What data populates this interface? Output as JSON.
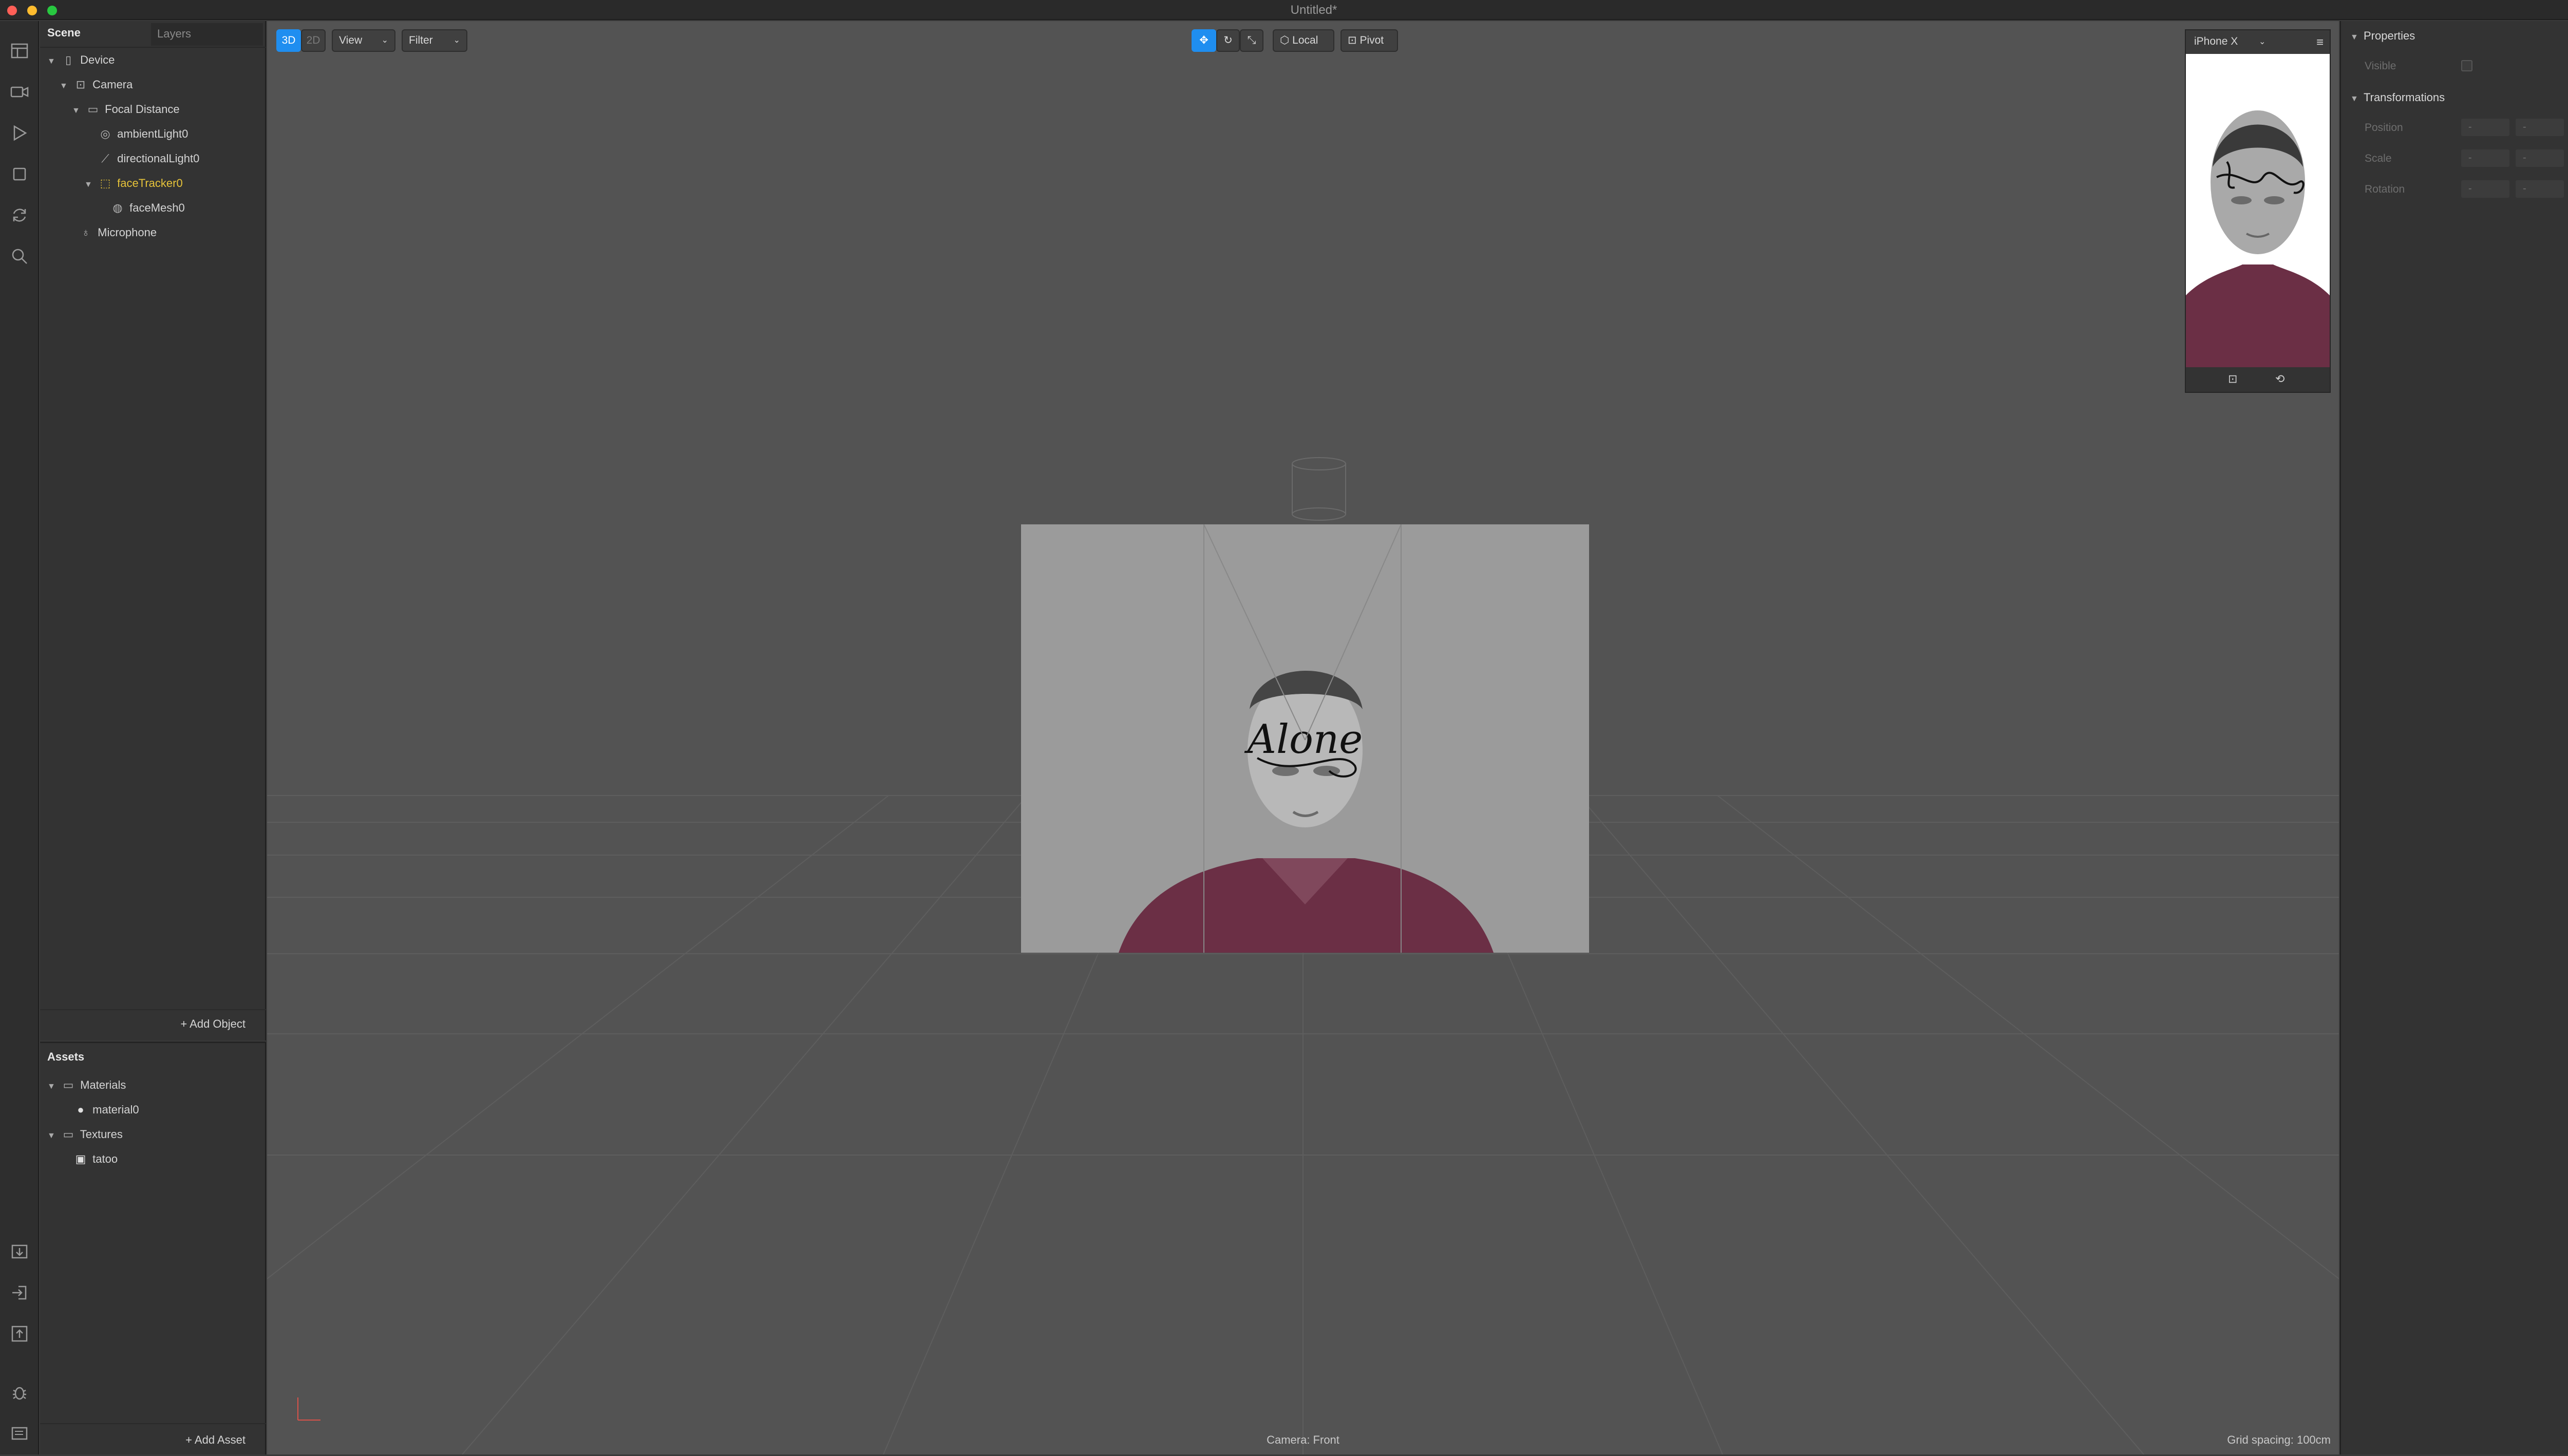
{
  "window": {
    "title": "Untitled*"
  },
  "scene_panel": {
    "tabs": [
      "Scene",
      "Layers"
    ],
    "tree": [
      {
        "label": "Device",
        "icon": "phone-icon",
        "expanded": true
      },
      {
        "label": "Camera",
        "icon": "video-camera-icon",
        "expanded": true
      },
      {
        "label": "Focal Distance",
        "icon": "ruler-icon",
        "expanded": true
      },
      {
        "label": "ambientLight0",
        "icon": "ambient-light-icon"
      },
      {
        "label": "directionalLight0",
        "icon": "directional-light-icon"
      },
      {
        "label": "faceTracker0",
        "icon": "face-tracker-icon",
        "expanded": true,
        "selected": true
      },
      {
        "label": "faceMesh0",
        "icon": "face-mesh-icon"
      },
      {
        "label": "Microphone",
        "icon": "microphone-icon"
      }
    ],
    "add_object_label": "Add Object"
  },
  "assets_panel": {
    "title": "Assets",
    "tree": [
      {
        "label": "Materials",
        "icon": "folder-icon",
        "expanded": true
      },
      {
        "label": "material0",
        "icon": "material-sphere-icon"
      },
      {
        "label": "Textures",
        "icon": "folder-icon",
        "expanded": true
      },
      {
        "label": "tatoo",
        "icon": "texture-icon"
      }
    ],
    "add_asset_label": "Add Asset"
  },
  "viewport": {
    "mode_3d": "3D",
    "mode_2d": "2D",
    "view_label": "View",
    "filter_label": "Filter",
    "local_label": "Local",
    "pivot_label": "Pivot",
    "camera_label": "Camera: Front",
    "grid_spacing": "Grid spacing: 100cm",
    "face_text": "Alone"
  },
  "preview": {
    "device": "iPhone X"
  },
  "properties_panel": {
    "properties_header": "Properties",
    "visible_label": "Visible",
    "transformations_header": "Transformations",
    "rows": [
      {
        "label": "Position",
        "values": [
          "-",
          "-",
          "-"
        ]
      },
      {
        "label": "Scale",
        "values": [
          "-",
          "-",
          "-"
        ]
      },
      {
        "label": "Rotation",
        "values": [
          "-",
          "-",
          "-"
        ]
      }
    ]
  },
  "colors": {
    "accent": "#1f8ef0",
    "selected": "#e6c33a",
    "viewport_bg": "#535353",
    "shirt": "#6b2f45"
  }
}
